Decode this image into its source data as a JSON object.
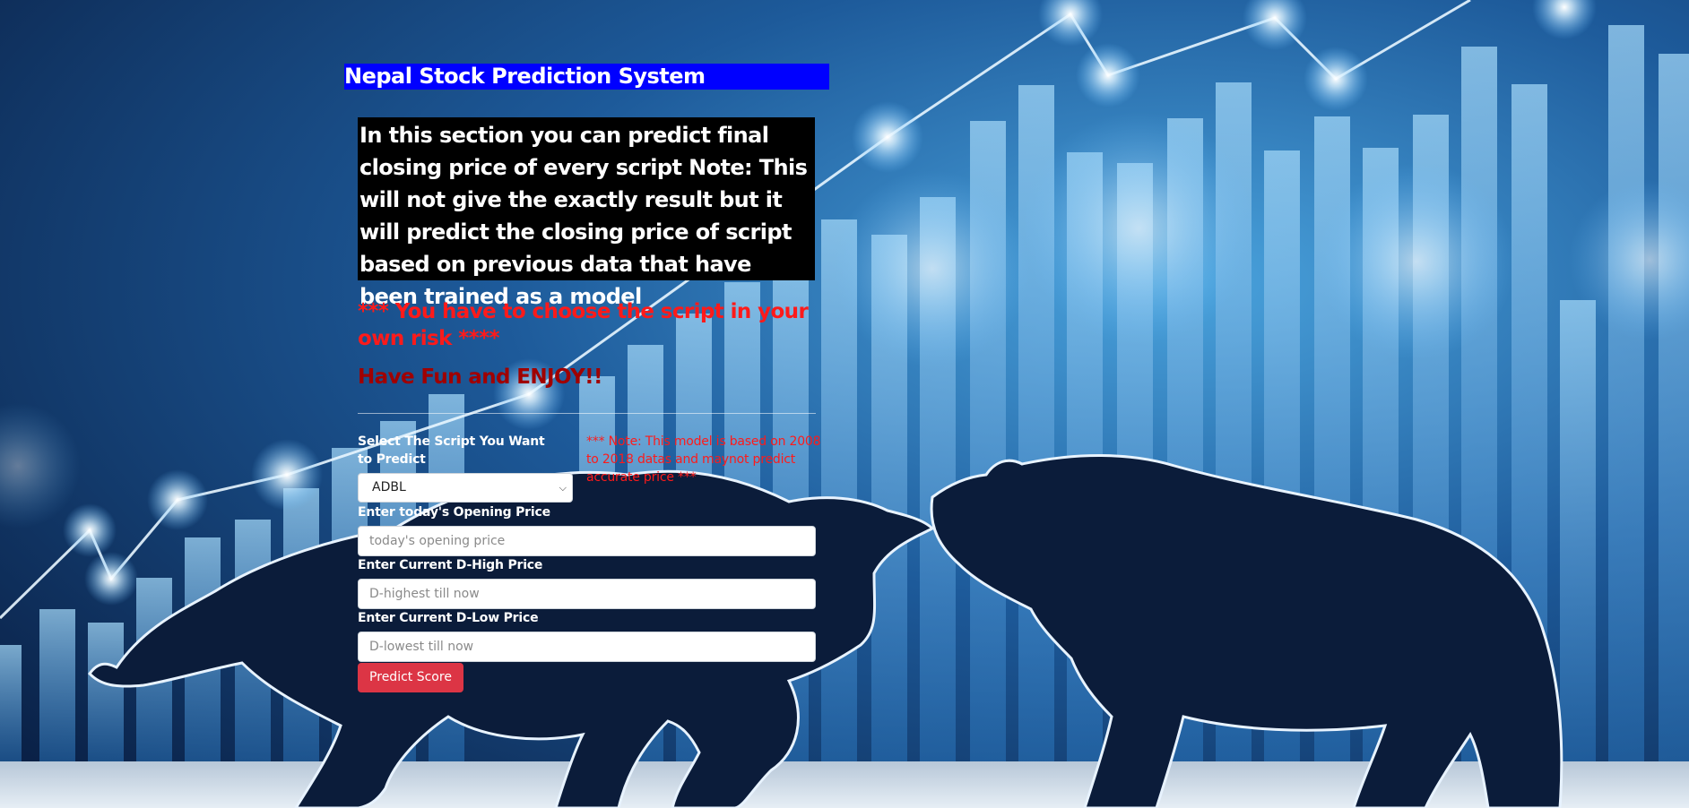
{
  "page": {
    "title": "Nepal Stock Prediction System",
    "intro": "In this section you can predict final closing price of every script Note: This will not give the exactly result but it will predict the closing price of script based on previous data that have been trained as a model",
    "warning": "*** You have to choose the script in your own risk ****",
    "enjoy": "Have Fun and ENJOY!!"
  },
  "form": {
    "script_label": "Select The Script You Want to Predict",
    "script_value": "ADBL",
    "note": "*** Note: This model is based on 2008 to 2018 datas and maynot predict accurate price ***",
    "opening_label": "Enter today's Opening Price",
    "opening_placeholder": "today's opening price",
    "high_label": "Enter Current D-High Price",
    "high_placeholder": "D-highest till now",
    "low_label": "Enter Current D-Low Price",
    "low_placeholder": "D-lowest till now",
    "submit_label": "Predict Score"
  },
  "colors": {
    "title_bg": "#0000ff",
    "intro_bg": "#000000",
    "warning": "#ff1a1a",
    "enjoy": "#a00000",
    "button": "#dc3545"
  }
}
